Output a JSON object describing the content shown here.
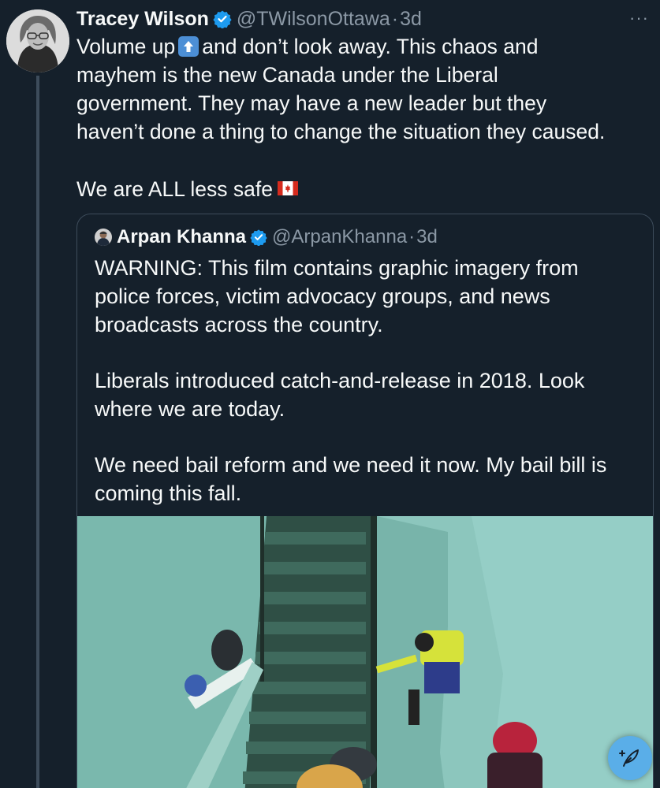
{
  "tweet": {
    "author_name": "Tracey Wilson",
    "handle": "@TWilsonOttawa",
    "separator": "·",
    "time": "3d",
    "more_label": "···",
    "lines": [
      [
        "Volume up ",
        "up-arrow-emoji",
        " and don’t look away. This chaos and"
      ],
      "mayhem is the new Canada under the Liberal",
      "government. They may have a new leader but they",
      "haven’t done a thing to change the situation they caused."
    ],
    "line1_before": "Volume up",
    "line1_after": "and don’t look away. This chaos and",
    "line2": "mayhem is the new Canada under the Liberal",
    "line3": "government. They may have a new leader but they",
    "line4": "haven’t done a thing to change the situation they caused.",
    "closing": "We are ALL less safe"
  },
  "quoted_tweet": {
    "author_name": "Arpan Khanna",
    "handle": "@ArpanKhanna",
    "separator": "·",
    "time": "3d",
    "line1": "WARNING: This film contains graphic imagery from",
    "line2": "police forces, victim advocacy groups, and news",
    "line3": "broadcasts across the country.",
    "line4": "Liberals introduced catch-and-release in 2018. Look",
    "line5": "where we are today.",
    "line6": "We need bail reform and we need it now. My bail bill is",
    "line7": "coming this fall."
  },
  "icons": {
    "verified": "verified-badge-icon",
    "up_emoji": "up-arrow-emoji-icon",
    "flag": "canada-flag-icon",
    "compose": "compose-feather-icon",
    "more": "more-dots-icon"
  },
  "colors": {
    "background": "#15202b",
    "verified_blue": "#1d9bf0",
    "secondary_text": "#8b98a5",
    "border": "#3d4c5b",
    "fab": "#5aaee8"
  }
}
